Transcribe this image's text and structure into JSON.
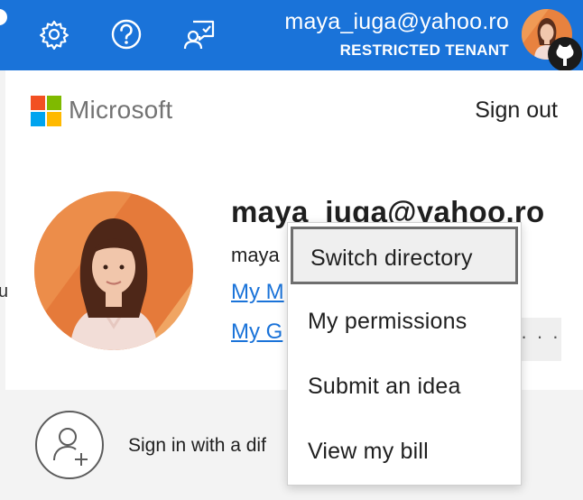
{
  "topbar": {
    "icons": [
      "gear-icon",
      "help-icon",
      "feedback-icon"
    ],
    "user_name": "maya_iuga@yahoo.ro",
    "tenant_label": "RESTRICTED TENANT",
    "accent_color": "#1a73d9"
  },
  "panel": {
    "brand": "Microsoft",
    "sign_out": "Sign out",
    "account": {
      "display_name": "maya_iuga@yahoo.ro",
      "email_partial": "maya",
      "link_1_partial": "My M",
      "link_2_partial": "My G"
    },
    "more_options": "· · ·",
    "sign_in_other": "Sign in with a dif"
  },
  "background": {
    "cutoff_text": "u"
  },
  "menu": {
    "items": [
      {
        "label": "Switch directory",
        "active": true
      },
      {
        "label": "My permissions"
      },
      {
        "label": "Submit an idea"
      },
      {
        "label": "View my bill"
      }
    ]
  }
}
